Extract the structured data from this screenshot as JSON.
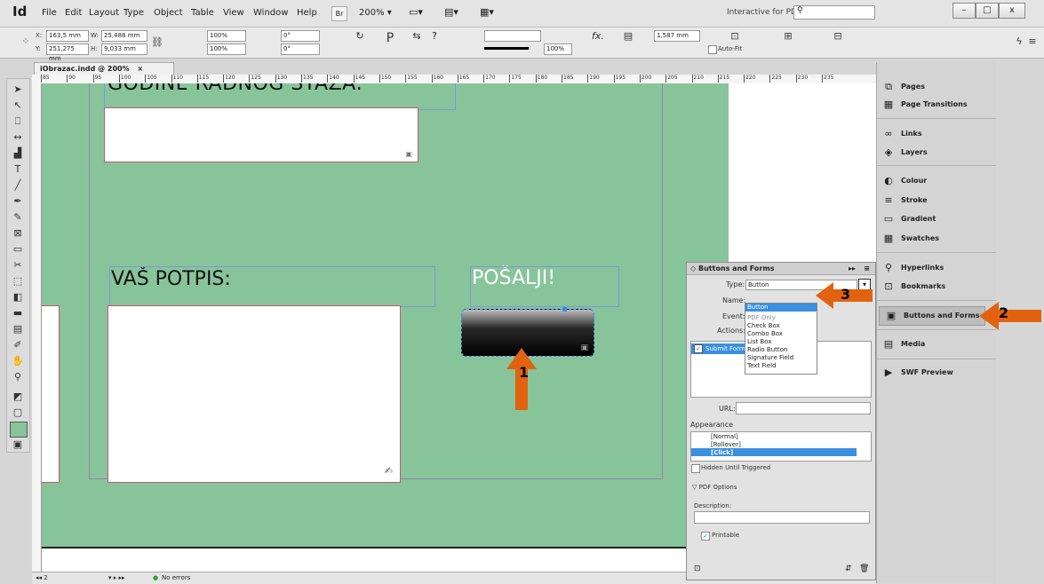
{
  "app": {
    "logo": "Id",
    "menu": [
      "File",
      "Edit",
      "Layout",
      "Type",
      "Object",
      "Table",
      "View",
      "Window",
      "Help"
    ],
    "bridge_label": "Br",
    "zoom": "200%",
    "workspace": "Interactive for PDF",
    "window_controls": {
      "minimize": "–",
      "maximize": "□",
      "close": "x"
    }
  },
  "control": {
    "x_label": "X:",
    "x_value": "163,5 mm",
    "y_label": "Y:",
    "y_value": "251,275 mm",
    "w_label": "W:",
    "w_value": "25,488 mm",
    "h_label": "H:",
    "h_value": "9,033 mm",
    "scale_x": "100%",
    "scale_y": "100%",
    "angle": "0°",
    "shear": "0°",
    "stroke_weight": "1,587 mm",
    "opacity": "100%",
    "autofit_label": "Auto-Fit",
    "fx_label": "fx."
  },
  "document": {
    "tab_title": "iObrazac.indd @ 200%",
    "tab_close": "×",
    "ruler_ticks": [
      "85",
      "90",
      "95",
      "100",
      "105",
      "110",
      "115",
      "120",
      "125",
      "130",
      "135",
      "140",
      "145",
      "150",
      "155",
      "160",
      "165",
      "170",
      "175",
      "180",
      "185",
      "190",
      "195",
      "200",
      "205",
      "210",
      "215",
      "220",
      "225",
      "230",
      "235"
    ],
    "text_top": "GODINE RADNOG STAŽA:",
    "text_signature": "VAŠ POTPIS:",
    "text_send": "POŠALJI!"
  },
  "statusbar": {
    "page": "2",
    "errors": "No errors"
  },
  "panels": [
    {
      "label": "Pages",
      "icon": "pages-icon",
      "glyph": "⧉"
    },
    {
      "label": "Page Transitions",
      "icon": "page-transitions-icon",
      "glyph": "▦"
    },
    {
      "label": "Links",
      "icon": "links-icon",
      "glyph": "∞"
    },
    {
      "label": "Layers",
      "icon": "layers-icon",
      "glyph": "◈"
    },
    {
      "label": "Colour",
      "icon": "colour-icon",
      "glyph": "◐"
    },
    {
      "label": "Stroke",
      "icon": "stroke-icon",
      "glyph": "≡"
    },
    {
      "label": "Gradient",
      "icon": "gradient-icon",
      "glyph": "▭"
    },
    {
      "label": "Swatches",
      "icon": "swatches-icon",
      "glyph": "▦"
    },
    {
      "label": "Hyperlinks",
      "icon": "hyperlinks-icon",
      "glyph": "⚲"
    },
    {
      "label": "Bookmarks",
      "icon": "bookmarks-icon",
      "glyph": "⊡"
    },
    {
      "label": "Buttons and Forms",
      "icon": "buttons-forms-icon",
      "glyph": "▣"
    },
    {
      "label": "Media",
      "icon": "media-icon",
      "glyph": "▤"
    },
    {
      "label": "SWF Preview",
      "icon": "swf-preview-icon",
      "glyph": "▶"
    }
  ],
  "buttons_forms": {
    "title": "Buttons and Forms",
    "type_label": "Type:",
    "type_value": "Button",
    "name_label": "Name:",
    "event_label": "Event:",
    "actions_label": "Actions:",
    "action_item": "Submit Form",
    "url_label": "URL:",
    "appearance_label": "Appearance",
    "states": [
      "[Normal]",
      "[Rollover]",
      "[Click]"
    ],
    "hidden_label": "Hidden Until Triggered",
    "pdf_options_label": "PDF Options",
    "description_label": "Description:",
    "printable_label": "Printable",
    "dropdown_options": [
      "Button",
      "PDF Only",
      "Check Box",
      "Combo Box",
      "List Box",
      "Radio Button",
      "Signature Field",
      "Text Field"
    ]
  },
  "annotations": [
    "1",
    "2",
    "3"
  ],
  "colors": {
    "page_green": "#88c49a",
    "arrow_orange": "#e2620f",
    "highlight_blue": "#3a8fe0"
  }
}
